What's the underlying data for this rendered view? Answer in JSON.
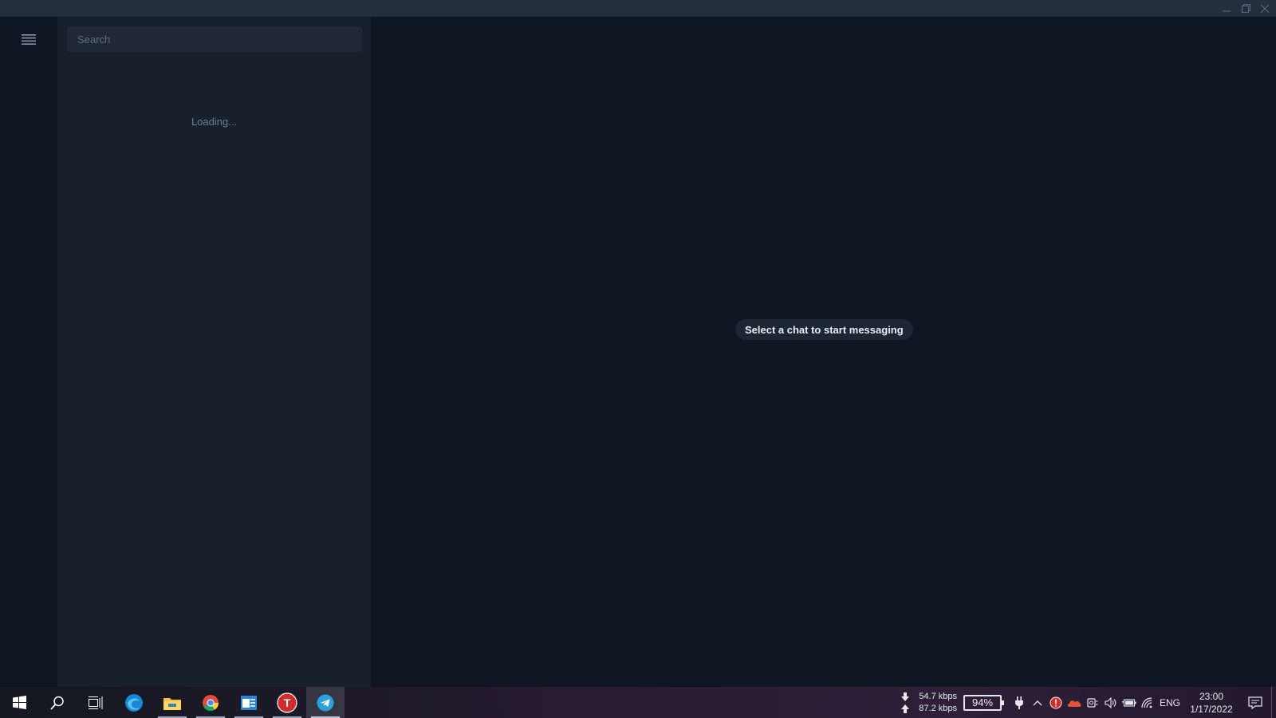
{
  "window": {
    "controls": [
      "minimize",
      "restore",
      "close"
    ]
  },
  "sidebar": {
    "menu_icon": "hamburger-menu-icon",
    "search": {
      "placeholder": "Search",
      "value": ""
    },
    "loading_text": "Loading..."
  },
  "main": {
    "empty_state": "Select a chat to start messaging"
  },
  "taskbar": {
    "apps": [
      {
        "name": "start",
        "icon": "windows-logo-icon"
      },
      {
        "name": "search",
        "icon": "search-icon"
      },
      {
        "name": "task-view",
        "icon": "task-view-icon"
      },
      {
        "name": "edge",
        "icon": "edge-browser-icon"
      },
      {
        "name": "file-explorer",
        "icon": "folder-icon"
      },
      {
        "name": "chrome",
        "icon": "chrome-icon"
      },
      {
        "name": "app-window",
        "icon": "app-window-icon"
      },
      {
        "name": "t-app",
        "icon": "t-app-icon",
        "letter": "T"
      },
      {
        "name": "telegram",
        "icon": "telegram-icon"
      }
    ],
    "network": {
      "download": "54.7 kbps",
      "upload": "87.2 kbps"
    },
    "battery_percent": "94%",
    "language": "ENG",
    "time": "23:00",
    "date": "1/17/2022"
  },
  "colors": {
    "sidebar_bg": "#17212b",
    "main_bg": "#0e1621",
    "titlebar_bg": "#242f3d",
    "accent": "#2aa1da"
  }
}
